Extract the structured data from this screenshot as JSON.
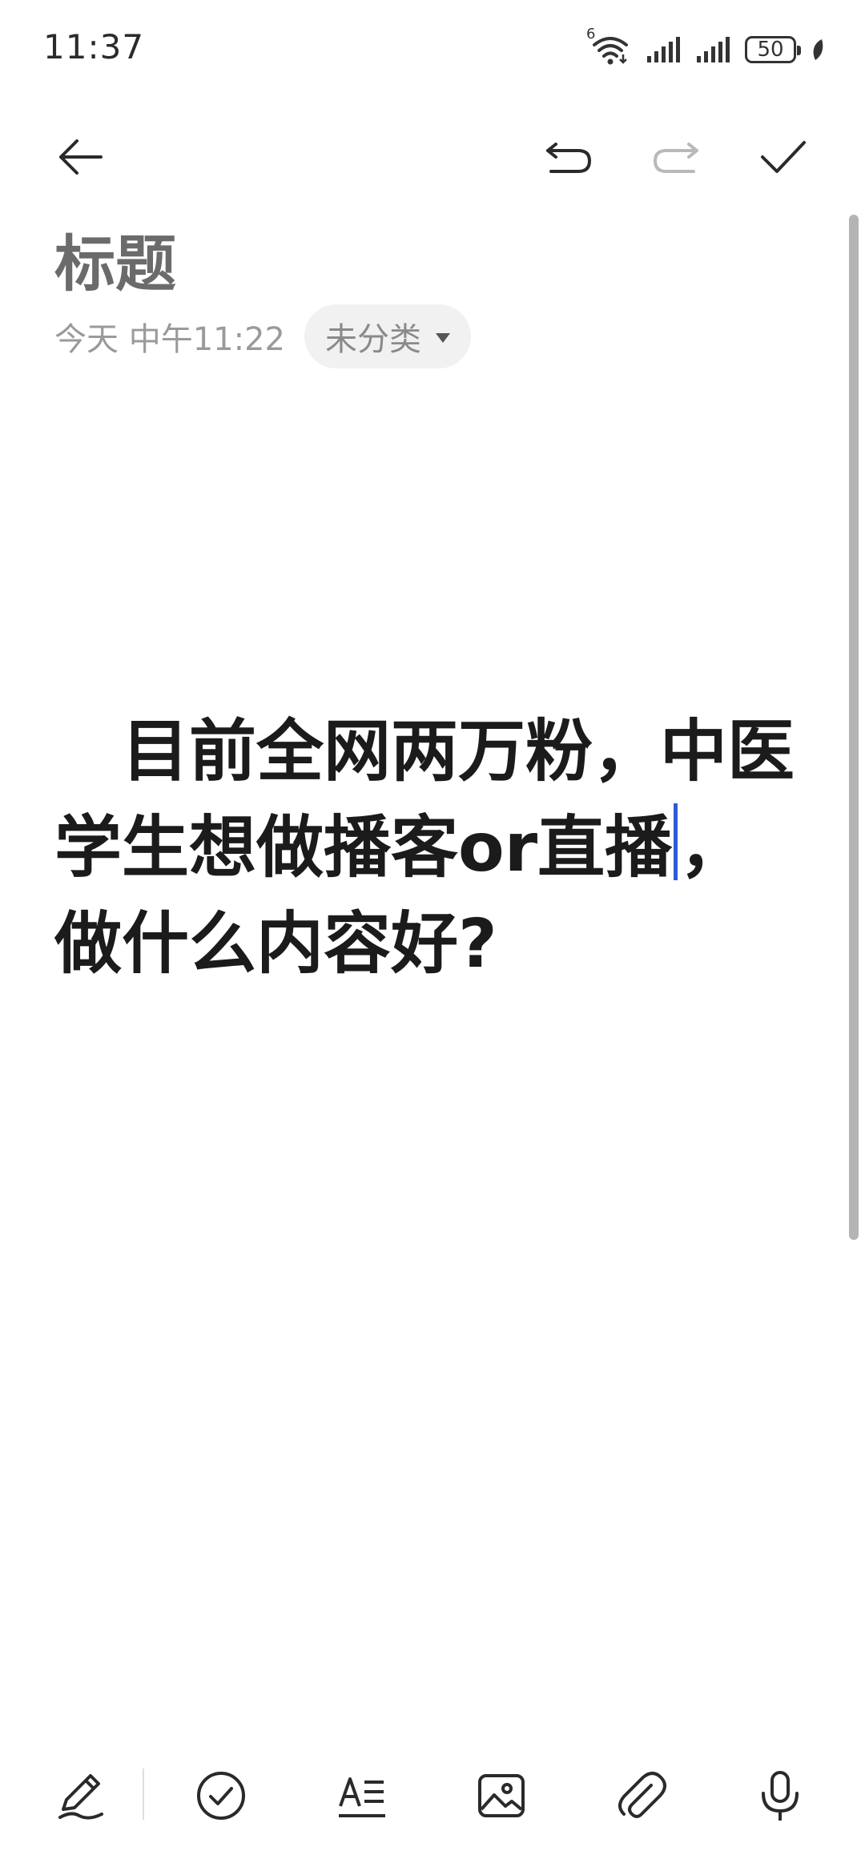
{
  "status_bar": {
    "time": "11:37",
    "network_badge": "6",
    "battery_level": "50",
    "icons": [
      "wifi-icon",
      "signal-icon",
      "signal-icon",
      "battery-icon",
      "leaf-icon"
    ]
  },
  "toolbar": {
    "icons": [
      "back-arrow-icon",
      "undo-icon",
      "redo-icon",
      "check-icon"
    ]
  },
  "note": {
    "title_placeholder": "标题",
    "date": "今天 中午11:22",
    "category": "未分类",
    "body_before_cursor": "　目前全网两万粉，中医学生想做播客or直播",
    "body_after_cursor": "，做什么内容好?"
  },
  "bottom_toolbar": {
    "icons": [
      "pen-icon",
      "checklist-icon",
      "text-format-icon",
      "image-icon",
      "attachment-icon",
      "microphone-icon"
    ]
  },
  "colors": {
    "cursor": "#2f5bd6",
    "title_placeholder": "#6b6b6b",
    "meta_text": "#9a9a9a",
    "chip_bg": "#f1f1f1"
  }
}
